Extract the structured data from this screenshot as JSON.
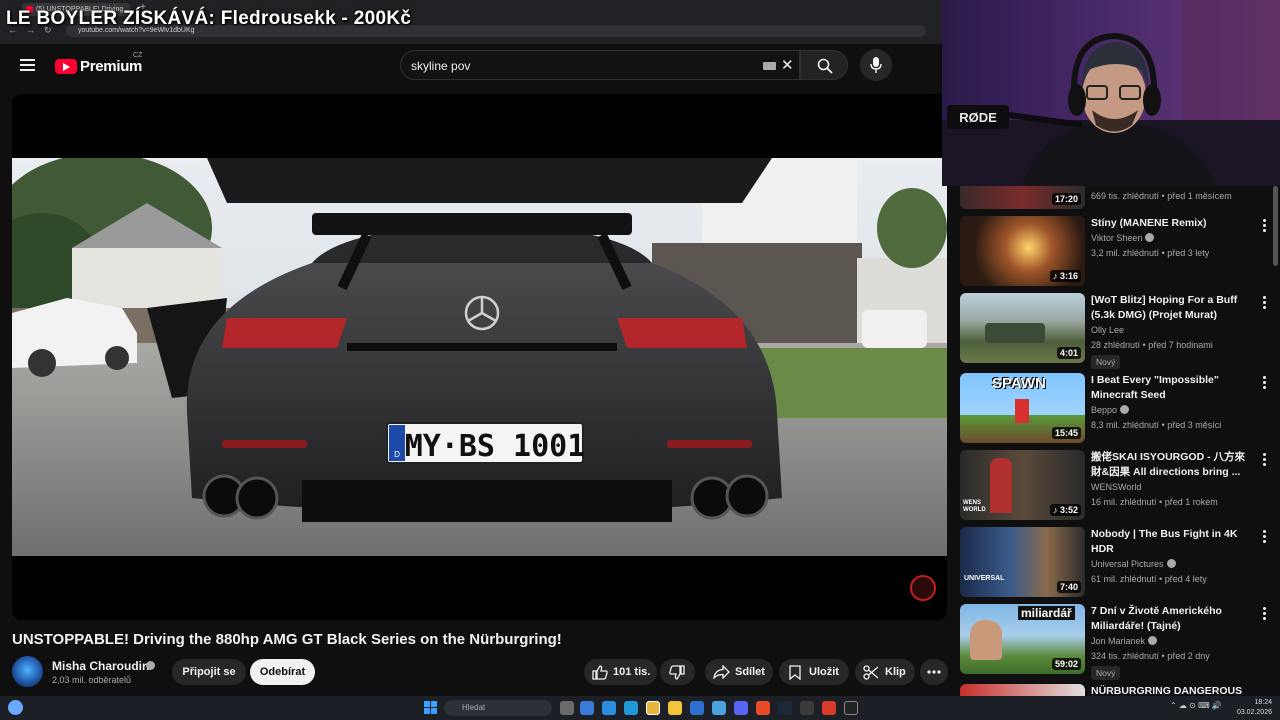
{
  "overlay_title": "LE BOYLER ZÍSKÁVÁ: Fledrousekk - 200Kč",
  "browser": {
    "tab_title": "(5) UNSTOPPABLE! Driving",
    "new_tab": "+",
    "url": "youtube.com/watch?v=9eWlv1dbUKg"
  },
  "header": {
    "logo_text": "Premium",
    "country": "CZ",
    "search_value": "skyline pov",
    "clear_glyph": "✕"
  },
  "video": {
    "title": "UNSTOPPABLE! Driving the 880hp AMG GT Black Series on the Nürburgring!",
    "plate": "MY·BS 1001",
    "plate_country": "D"
  },
  "channel": {
    "name": "Misha Charoudin",
    "subscribers": "2,03 mil. odběratelů",
    "join_label": "Připojit se",
    "subscribed_label": "Odebírat"
  },
  "actions": {
    "likes": "101 tis.",
    "share": "Sdílet",
    "save": "Uložit",
    "clip": "Klip"
  },
  "recommendations": [
    {
      "title": "",
      "channel": "",
      "meta": "669 tis. zhlédnutí • před 1 měsícem",
      "duration": "17:20",
      "new": ""
    },
    {
      "title": "Stíny (MANENE Remix)",
      "channel": "Viktor Sheen",
      "meta": "3,2 mil. zhlédnutí • před 3 lety",
      "duration": "♪ 3:16",
      "new": ""
    },
    {
      "title": "[WoT Blitz] Hoping For a Buff (5.3k DMG) (Projet Murat)",
      "channel": "Olly Lee",
      "meta": "28 zhlédnutí • před 7 hodinami",
      "duration": "4:01",
      "new": "Nový"
    },
    {
      "title": "I Beat Every \"Impossible\" Minecraft Seed",
      "channel": "Beppo",
      "meta": "8,3 mil. zhlédnutí • před 3 měsíci",
      "duration": "15:45",
      "new": ""
    },
    {
      "title": "搬佬SKAI ISYOURGOD - 八方來財&因果 All directions bring ...",
      "channel": "WENSWorld",
      "meta": "16 mil. zhlédnutí • před 1 rokem",
      "duration": "♪ 3:52",
      "new": ""
    },
    {
      "title": "Nobody | The Bus Fight in 4K HDR",
      "channel": "Universal Pictures",
      "meta": "61 mil. zhlédnutí • před 4 lety",
      "duration": "7:40",
      "new": ""
    },
    {
      "title": "7 Dní v Životě Amerického Miliardáře! (Tajné)",
      "channel": "Jon Marianek",
      "meta": "324 tis. zhlédnutí • před 2 dny",
      "duration": "59:02",
      "new": "Nový"
    },
    {
      "title": "NÜRBURGRING DANGEROUS &",
      "channel": "",
      "meta": "",
      "duration": "",
      "new": ""
    }
  ],
  "thumb_text": {
    "spawn": "SPAWN",
    "miliardar": "miliardář",
    "universal": "UNIVERSAL",
    "wens": "WENS WORLD"
  },
  "webcam": {
    "mic_brand": "RØDE"
  },
  "taskbar": {
    "search_placeholder": "Hledat",
    "time": "18:24",
    "date": "03.02.2026"
  },
  "colors": {
    "background": "#0f0f0f",
    "brand_red": "#ff0033",
    "text_primary": "#f1f1f1",
    "text_secondary": "#aaaaaa",
    "chip": "#272727"
  }
}
